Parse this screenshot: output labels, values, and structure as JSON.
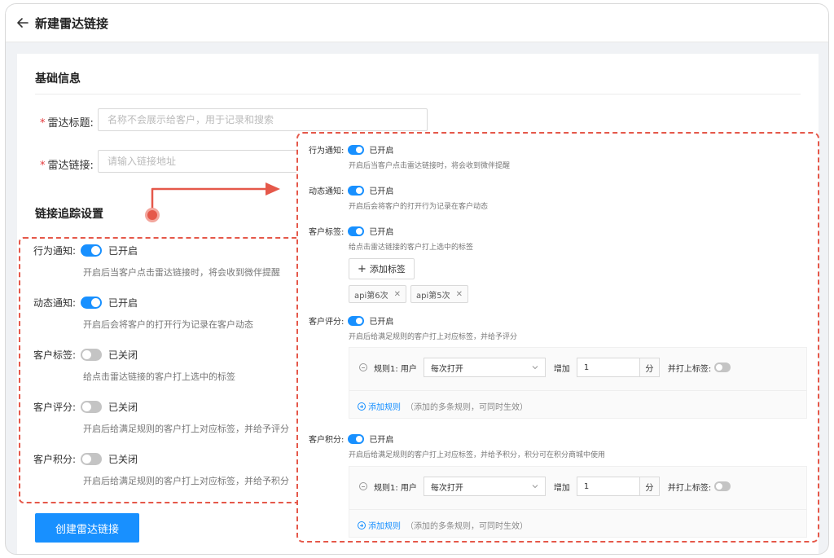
{
  "header": {
    "title": "新建雷达链接"
  },
  "basic": {
    "section_title": "基础信息",
    "title_label": "雷达标题:",
    "title_placeholder": "名称不会展示给客户，用于记录和搜索",
    "link_label": "雷达链接:",
    "link_placeholder": "请输入链接地址"
  },
  "tracking": {
    "section_title": "链接追踪设置",
    "items": [
      {
        "label": "行为通知:",
        "state": "已开启",
        "on": true,
        "desc": "开启后当客户点击雷达链接时，将会收到微伴提醒"
      },
      {
        "label": "动态通知:",
        "state": "已开启",
        "on": true,
        "desc": "开启后会将客户的打开行为记录在客户动态"
      },
      {
        "label": "客户标签:",
        "state": "已关闭",
        "on": false,
        "desc": "给点击雷达链接的客户打上选中的标签"
      },
      {
        "label": "客户评分:",
        "state": "已关闭",
        "on": false,
        "desc": "开启后给满足规则的客户打上对应标签，并给予评分"
      },
      {
        "label": "客户积分:",
        "state": "已关闭",
        "on": false,
        "desc": "开启后给满足规则的客户打上对应标签，并给予积分"
      }
    ],
    "create_button": "创建雷达链接"
  },
  "expanded": {
    "behavior": {
      "label": "行为通知:",
      "state": "已开启",
      "desc": "开启后当客户点击雷达链接时，将会收到微伴提醒"
    },
    "dynamic": {
      "label": "动态通知:",
      "state": "已开启",
      "desc": "开启后会将客户的打开行为记录在客户动态"
    },
    "tags": {
      "label": "客户标签:",
      "state": "已开启",
      "desc": "给点击雷达链接的客户打上选中的标签",
      "add_button": "添加标签",
      "chips": [
        "api第6次",
        "api第5次"
      ]
    },
    "score": {
      "label": "客户评分:",
      "state": "已开启",
      "desc": "开启后给满足规则的客户打上对应标签，并给予评分",
      "rule_label": "规则1: 用户",
      "select_value": "每次打开",
      "increase_label": "增加",
      "amount": "1",
      "unit": "分",
      "tag_label": "并打上标签:",
      "add_rule": "添加规则",
      "hint": "（添加的多条规则，可同时生效）"
    },
    "points": {
      "label": "客户积分:",
      "state": "已开启",
      "desc": "开启后给满足规则的客户打上对应标签，并给予积分，积分可在积分商城中使用",
      "rule_label": "规则1: 用户",
      "select_value": "每次打开",
      "increase_label": "增加",
      "amount": "1",
      "unit": "分",
      "tag_label": "并打上标签:",
      "add_rule": "添加规则",
      "hint": "（添加的多条规则，可同时生效）"
    }
  },
  "colors": {
    "primary": "#1890ff",
    "annotation": "#e5584a",
    "toggle_off": "#c4c4c4"
  }
}
